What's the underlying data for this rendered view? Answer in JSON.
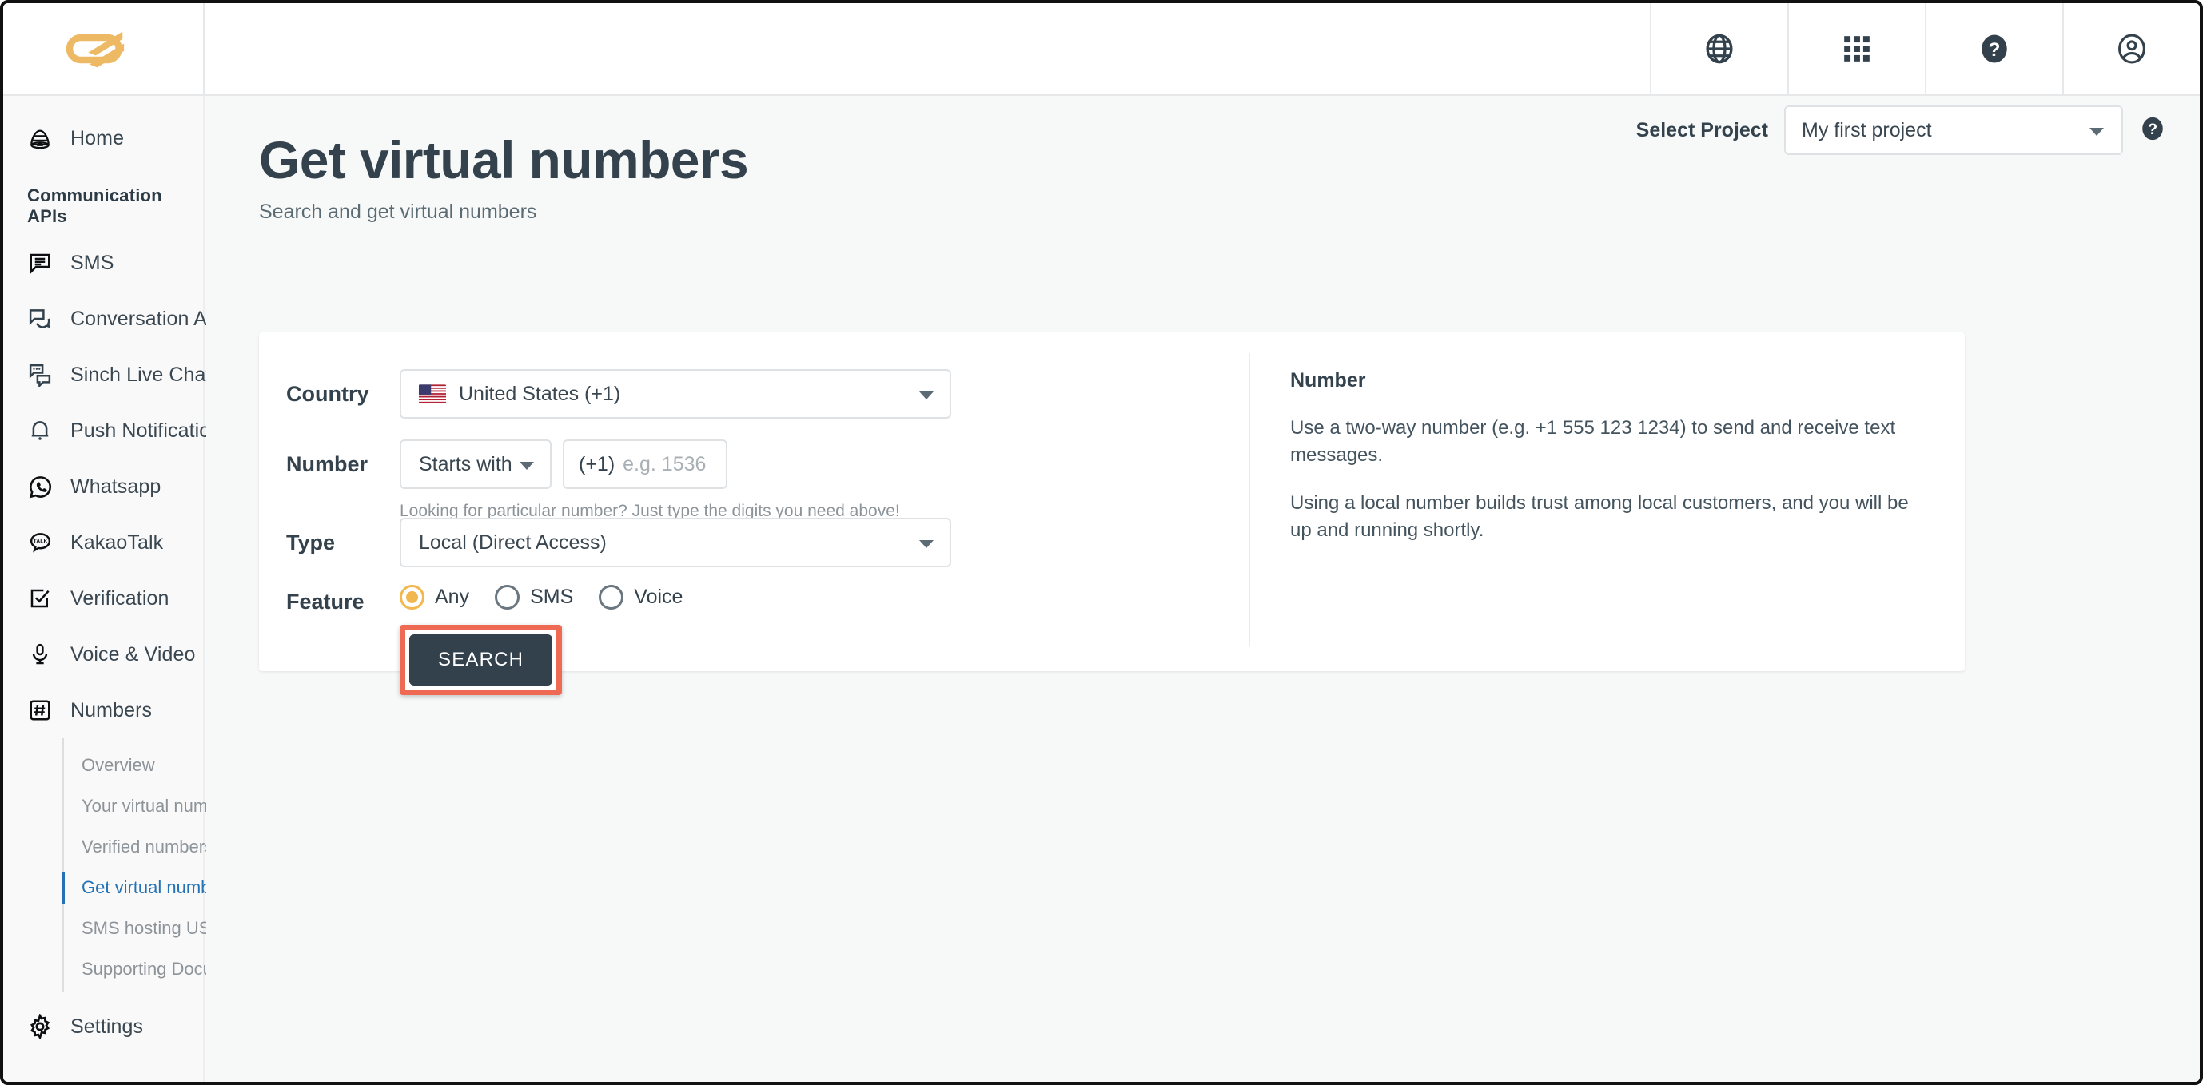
{
  "topbar": {
    "logo_name": "sinch-logo",
    "logo_color": "#eeb964",
    "icons": [
      {
        "name": "globe-icon",
        "title": "Language"
      },
      {
        "name": "apps-grid-icon",
        "title": "Apps"
      },
      {
        "name": "help-circle-icon",
        "title": "Help"
      },
      {
        "name": "account-avatar-icon",
        "title": "Account"
      }
    ]
  },
  "sidebar": {
    "home": {
      "label": "Home",
      "icon": "beehive-icon"
    },
    "section_title": "Communication APIs",
    "items": [
      {
        "label": "SMS",
        "icon": "chat-bubble-lines-icon"
      },
      {
        "label": "Conversation API",
        "icon": "two-chat-bubbles-icon"
      },
      {
        "label": "Sinch Live Chat",
        "icon": "chat-bubbles-dots-icon"
      },
      {
        "label": "Push Notifications",
        "icon": "bell-icon"
      },
      {
        "label": "Whatsapp",
        "icon": "whatsapp-icon"
      },
      {
        "label": "KakaoTalk",
        "icon": "kakaotalk-icon"
      },
      {
        "label": "Verification",
        "icon": "checkbox-check-icon"
      },
      {
        "label": "Voice & Video",
        "icon": "microphone-icon"
      },
      {
        "label": "Numbers",
        "icon": "hash-square-icon"
      }
    ],
    "subitems": [
      {
        "label": "Overview",
        "active": false
      },
      {
        "label": "Your virtual numbers",
        "active": false
      },
      {
        "label": "Verified numbers",
        "active": false
      },
      {
        "label": "Get virtual numbers",
        "active": true
      },
      {
        "label": "SMS hosting USA/Canada",
        "active": false
      },
      {
        "label": "Supporting Documentation",
        "active": false
      }
    ],
    "settings": {
      "label": "Settings",
      "icon": "gear-icon"
    },
    "active_color": "#2272b5"
  },
  "page": {
    "title": "Get virtual numbers",
    "subtitle": "Search and get virtual numbers",
    "project_label": "Select Project",
    "project_value": "My first project",
    "project_help_icon": "help-circle-icon"
  },
  "form": {
    "country": {
      "label": "Country",
      "value": "United States (+1)",
      "flag": "us-flag-icon"
    },
    "number": {
      "label": "Number",
      "match_value": "Starts with",
      "prefix": "(+1)",
      "placeholder": "e.g. 1536",
      "hint": "Looking for particular number? Just type the digits you need above!"
    },
    "type": {
      "label": "Type",
      "value": "Local (Direct Access)"
    },
    "feature": {
      "label": "Feature",
      "options": [
        {
          "label": "Any",
          "selected": true
        },
        {
          "label": "SMS",
          "selected": false
        },
        {
          "label": "Voice",
          "selected": false
        }
      ],
      "selected_color": "#f2b74e"
    },
    "search_button": "SEARCH",
    "highlight_color": "#ee6a53"
  },
  "info_panel": {
    "title": "Number",
    "paragraphs": [
      "Use a two-way number (e.g. +1 555 123 1234) to send and receive text messages.",
      "Using a local number builds trust among local customers, and you will be up and running shortly."
    ]
  }
}
